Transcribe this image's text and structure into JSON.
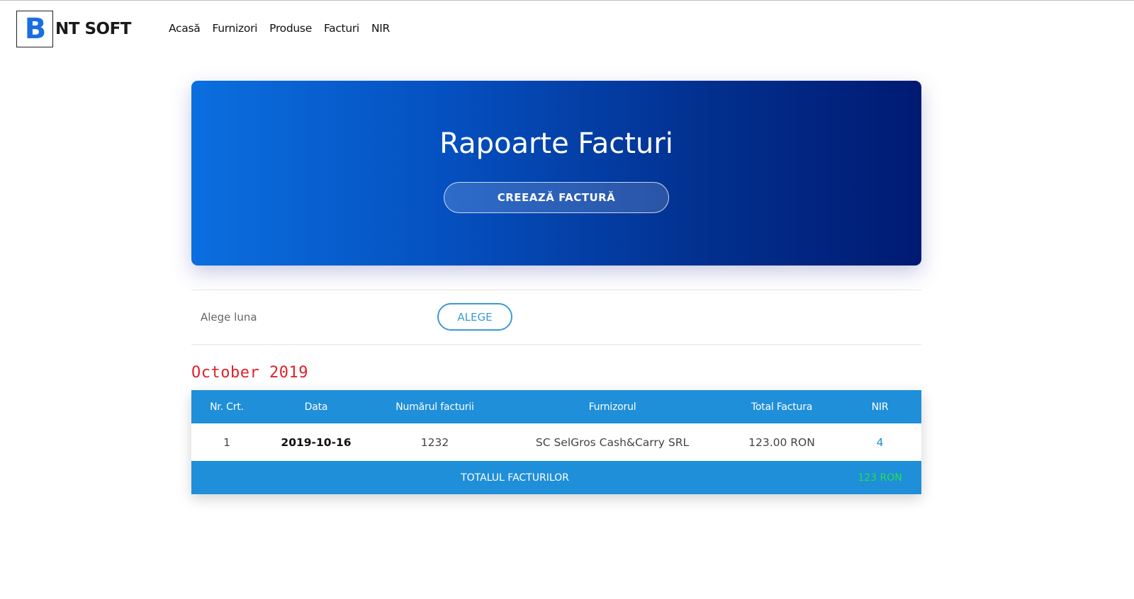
{
  "header": {
    "logo_letter": "B",
    "logo_text": "NT SOFT",
    "nav": [
      "Acasă",
      "Furnizori",
      "Produse",
      "Facturi",
      "NIR"
    ]
  },
  "hero": {
    "title": "Rapoarte Facturi",
    "button_label": "CREEAZĂ FACTURĂ",
    "gradient_colors": [
      "#0b6fdf",
      "#001a72"
    ]
  },
  "chooser": {
    "label": "Alege luna",
    "button_label": "ALEGE"
  },
  "month_heading": "October 2019",
  "table": {
    "columns": [
      "Nr. Crt.",
      "Data",
      "Numărul facturii",
      "Furnizorul",
      "Total Factura",
      "NIR"
    ],
    "rows": [
      {
        "nr": "1",
        "data": "2019-10-16",
        "numar": "1232",
        "furnizor": "SC SelGros Cash&Carry SRL",
        "total": "123.00 RON",
        "nir": "4"
      }
    ],
    "footer_label": "TOTALUL FACTURILOR",
    "footer_total": "123 RON"
  },
  "colors": {
    "accent": "#1e8fd8",
    "month_heading": "#e0202b",
    "footer_total": "#22e04a"
  }
}
